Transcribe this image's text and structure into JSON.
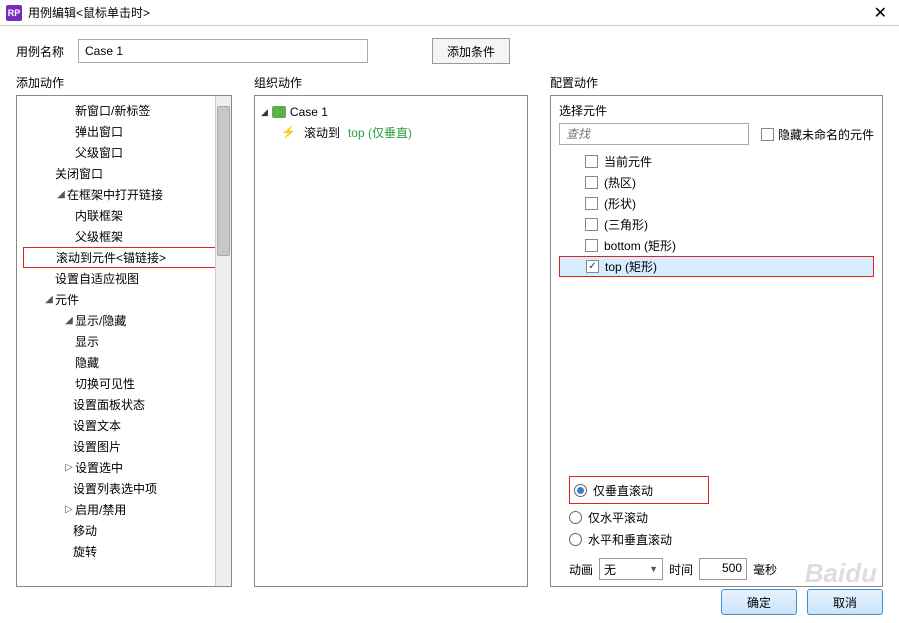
{
  "titlebar": {
    "title": "用例编辑<鼠标单击时>"
  },
  "header": {
    "name_label": "用例名称",
    "name_value": "Case 1",
    "add_condition": "添加条件"
  },
  "labels": {
    "add_action": "添加动作",
    "org_action": "组织动作",
    "config_action": "配置动作"
  },
  "left_tree": {
    "items": [
      {
        "indent": "i0",
        "label": "新窗口/新标签"
      },
      {
        "indent": "i0",
        "label": "弹出窗口"
      },
      {
        "indent": "i0",
        "label": "父级窗口"
      },
      {
        "indent": "i2",
        "label": "关闭窗口"
      },
      {
        "indent": "i2",
        "exp": "◢",
        "label": "在框架中打开链接"
      },
      {
        "indent": "i0",
        "label": "内联框架"
      },
      {
        "indent": "i0",
        "label": "父级框架"
      },
      {
        "indent": "i2",
        "label": "滚动到元件<锚链接>",
        "red": true
      },
      {
        "indent": "i2",
        "label": "设置自适应视图"
      },
      {
        "indent": "i1",
        "exp": "◢",
        "label": "元件"
      },
      {
        "indent": "i3",
        "exp": "◢",
        "label": "显示/隐藏"
      },
      {
        "indent": "i0",
        "label": "显示"
      },
      {
        "indent": "i0",
        "label": "隐藏"
      },
      {
        "indent": "i0",
        "label": "切换可见性"
      },
      {
        "indent": "i4",
        "label": "设置面板状态"
      },
      {
        "indent": "i4",
        "label": "设置文本"
      },
      {
        "indent": "i4",
        "label": "设置图片"
      },
      {
        "indent": "i3",
        "exp": "▷",
        "label": "设置选中"
      },
      {
        "indent": "i4",
        "label": "设置列表选中项"
      },
      {
        "indent": "i3",
        "exp": "▷",
        "label": "启用/禁用"
      },
      {
        "indent": "i4",
        "label": "移动"
      },
      {
        "indent": "i4",
        "label": "旋转"
      }
    ]
  },
  "mid": {
    "case_label": "Case 1",
    "action_label": "滚动到",
    "action_target": "top (仅垂直)"
  },
  "right": {
    "select_label": "选择元件",
    "search_placeholder": "查找",
    "hide_unnamed": "隐藏未命名的元件",
    "components": [
      {
        "label": "当前元件",
        "checked": false
      },
      {
        "label": "(热区)",
        "checked": false
      },
      {
        "label": "(形状)",
        "checked": false
      },
      {
        "label": "(三角形)",
        "checked": false
      },
      {
        "label": "bottom (矩形)",
        "checked": false
      },
      {
        "label": "top (矩形)",
        "checked": true,
        "sel": true,
        "red": true
      }
    ],
    "scroll_options": {
      "opt1": "仅垂直滚动",
      "opt2": "仅水平滚动",
      "opt3": "水平和垂直滚动"
    },
    "anim_label": "动画",
    "anim_value": "无",
    "time_label": "时间",
    "time_value": "500",
    "time_unit": "毫秒"
  },
  "footer": {
    "ok": "确定",
    "cancel": "取消"
  },
  "watermark": "Baidu"
}
